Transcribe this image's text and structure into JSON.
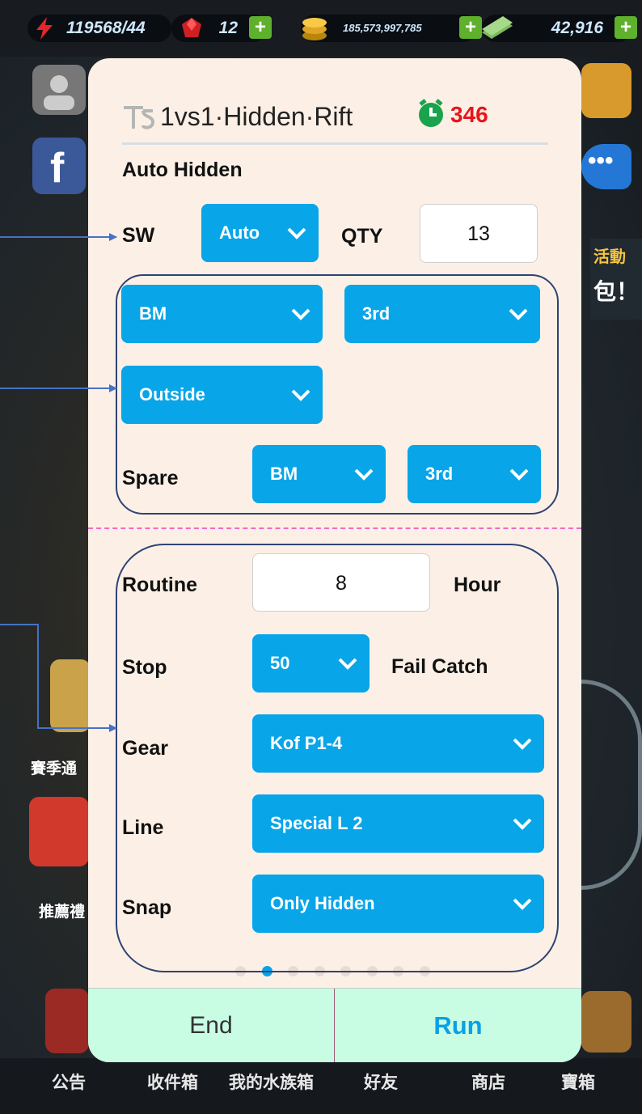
{
  "game": {
    "stats": [
      {
        "value": "119568/44",
        "icon": "lightning-icon"
      },
      {
        "value": "12",
        "icon": "ruby-gem-icon"
      },
      {
        "value": "185,573,997,785",
        "icon": "gold-coins-icon"
      },
      {
        "value": "42,916",
        "icon": "cash-stack-icon"
      }
    ],
    "bottom_nav": [
      "公告",
      "收件箱",
      "我的水族箱",
      "好友",
      "商店",
      "寶箱"
    ],
    "side_labels": {
      "season": "賽季通",
      "recommend": "推薦禮"
    },
    "right_text": {
      "line1": "活動",
      "line2": "包！"
    }
  },
  "panel": {
    "title": "1vs1·Hidden·Rift",
    "timer": "346",
    "section_title": "Auto Hidden",
    "sw": {
      "label": "SW",
      "value": "Auto"
    },
    "qty": {
      "label": "QTY",
      "value": "13"
    },
    "rod": {
      "value": "BM"
    },
    "rank": {
      "value": "3rd"
    },
    "position": {
      "value": "Outside"
    },
    "spare": {
      "label": "Spare",
      "rod": "BM",
      "rank": "3rd"
    },
    "routine": {
      "label": "Routine",
      "value": "8",
      "unit": "Hour"
    },
    "stop": {
      "label": "Stop",
      "value": "50",
      "unit": "Fail Catch"
    },
    "gear": {
      "label": "Gear",
      "value": "Kof P1-4"
    },
    "line": {
      "label": "Line",
      "value": "Special L 2"
    },
    "snap": {
      "label": "Snap",
      "value": "Only Hidden"
    },
    "page_dots": {
      "count": 8,
      "active": 2
    },
    "end_button": "End",
    "run_button": "Run"
  },
  "colors": {
    "accent": "#08a5e8",
    "panel_bg": "#fcf0e6",
    "button_bar": "#c9fde3",
    "timer_red": "#e8141b",
    "run_text": "#0aa1e6",
    "annotation_line": "#4572c4",
    "group_border": "#2e4374",
    "divider": "#f06bc0"
  }
}
